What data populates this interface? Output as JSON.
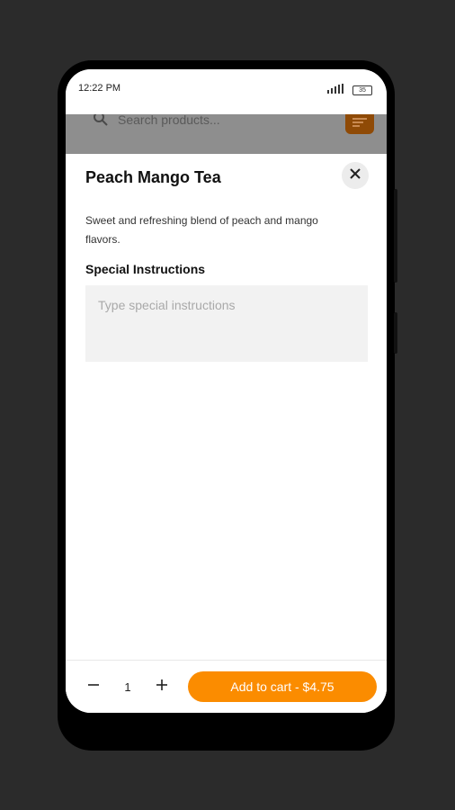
{
  "status_bar": {
    "time": "12:22 PM",
    "battery": "35"
  },
  "background_app": {
    "search_placeholder": "Search products..."
  },
  "product": {
    "name": "Peach Mango Tea",
    "description": "Sweet and refreshing blend of peach and mango flavors.",
    "special_instructions_label": "Special Instructions",
    "special_instructions_placeholder": "Type special instructions",
    "special_instructions_value": ""
  },
  "cart": {
    "quantity": "1",
    "add_button_label": "Add to cart - $4.75"
  },
  "colors": {
    "accent": "#fb8c00",
    "field_bg": "#f2f2f2",
    "overlay": "#8e8e8e"
  },
  "icons": {
    "search": "search-icon",
    "filter": "filter-icon",
    "close": "close-icon",
    "minus": "minus-icon",
    "plus": "plus-icon",
    "signal": "signal-icon",
    "battery": "battery-icon"
  }
}
